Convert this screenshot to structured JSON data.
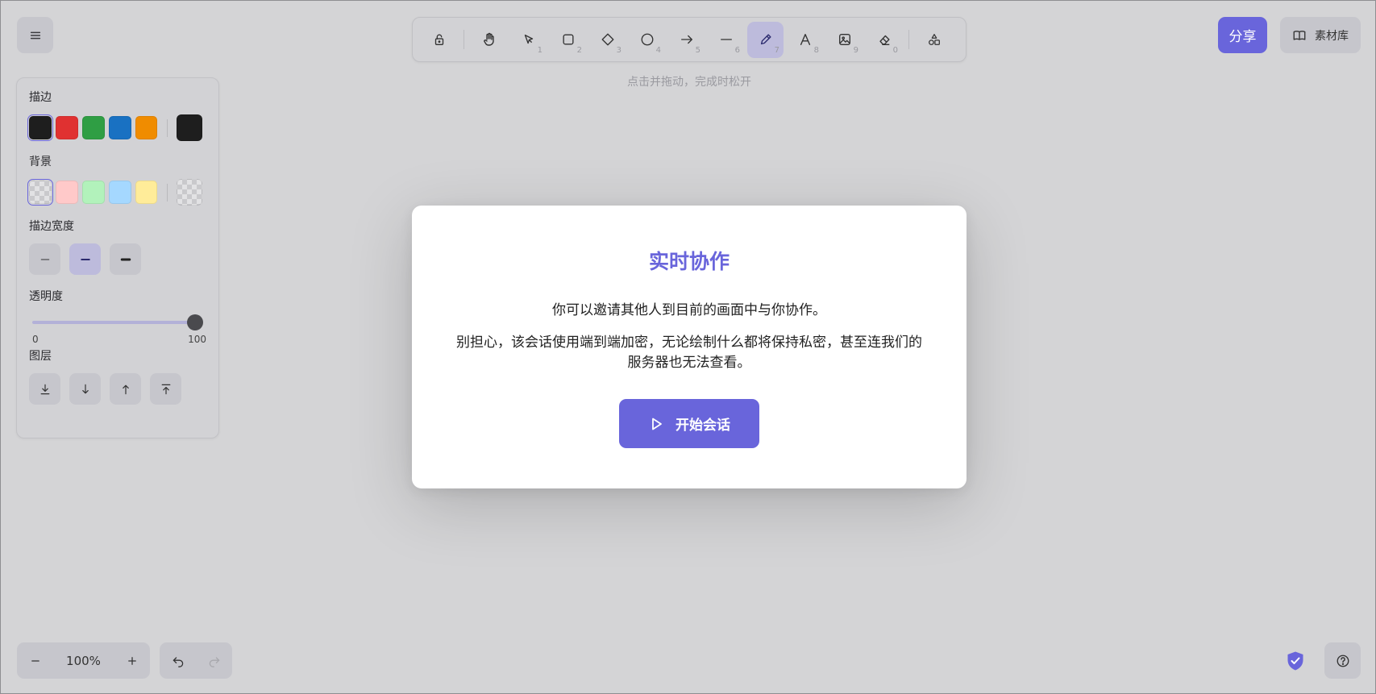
{
  "toolbar": {
    "tools": [
      {
        "name": "lock",
        "num": ""
      },
      {
        "name": "hand",
        "num": ""
      },
      {
        "name": "selection",
        "num": "1"
      },
      {
        "name": "rectangle",
        "num": "2"
      },
      {
        "name": "diamond",
        "num": "3"
      },
      {
        "name": "ellipse",
        "num": "4"
      },
      {
        "name": "arrow",
        "num": "5"
      },
      {
        "name": "line",
        "num": "6"
      },
      {
        "name": "pencil",
        "num": "7"
      },
      {
        "name": "text",
        "num": "8"
      },
      {
        "name": "image",
        "num": "9"
      },
      {
        "name": "eraser",
        "num": "0"
      },
      {
        "name": "shapes",
        "num": ""
      }
    ],
    "active_tool": "pencil",
    "hint": "点击并拖动，完成时松开"
  },
  "header": {
    "share_label": "分享",
    "library_label": "素材库"
  },
  "panel": {
    "stroke_label": "描边",
    "stroke_colors": [
      "#1e1e1e",
      "#e03131",
      "#2f9e44",
      "#1971c2",
      "#f08c00"
    ],
    "stroke_current": "#1e1e1e",
    "background_label": "背景",
    "background_colors": [
      "transparent",
      "#ffc9c9",
      "#b2f2bb",
      "#a5d8ff",
      "#ffec99"
    ],
    "background_current": "transparent",
    "stroke_width_label": "描边宽度",
    "stroke_width_selected": "medium",
    "opacity_label": "透明度",
    "opacity_min": "0",
    "opacity_max": "100",
    "opacity_value": 100,
    "layers_label": "图层"
  },
  "modal": {
    "title": "实时协作",
    "paragraph1": "你可以邀请其他人到目前的画面中与你协作。",
    "paragraph2": "别担心，该会话使用端到端加密，无论绘制什么都将保持私密，甚至连我们的服务器也无法查看。",
    "button_label": "开始会话"
  },
  "footer": {
    "zoom": "100%"
  },
  "colors": {
    "accent": "#6965db",
    "background": "#d4d4d6"
  }
}
